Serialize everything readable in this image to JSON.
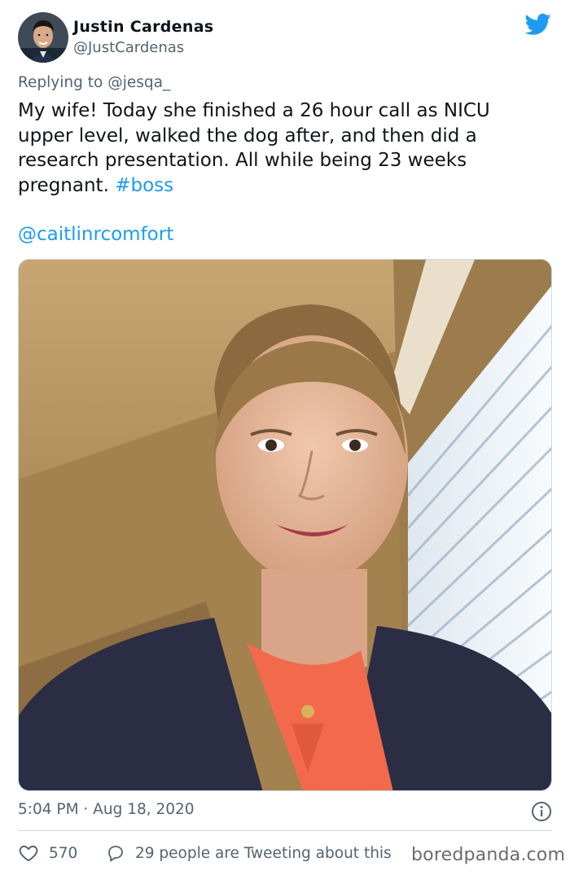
{
  "author": {
    "name": "Justin Cardenas",
    "handle": "@JustCardenas"
  },
  "reply": {
    "prefix": "Replying to ",
    "to": "@jesqa_"
  },
  "tweet": {
    "lines": [
      "My wife! Today she finished a 26 hour call as NICU",
      "upper level, walked the dog after, and then did a",
      "research presentation. All while being 23 weeks"
    ],
    "last_line_text": "pregnant. ",
    "hashtag": "#boss",
    "mention": "@caitlinrcomfort"
  },
  "meta": {
    "timestamp": "5:04 PM · Aug 18, 2020"
  },
  "actions": {
    "likes": "570",
    "talking": "29 people are Tweeting about this"
  },
  "watermark": "boredpanda.com",
  "icons": {
    "brand": "twitter-bird-icon",
    "info": "info-icon",
    "like": "heart-icon",
    "reply": "speech-bubble-icon"
  },
  "colors": {
    "link": "#1d9bf0",
    "muted": "#536471",
    "text": "#0f1419"
  }
}
